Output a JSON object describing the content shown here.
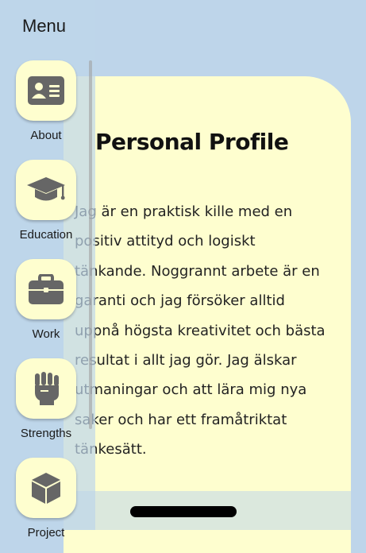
{
  "menu": {
    "title": "Menu",
    "items": [
      {
        "label": "About",
        "icon": "id-card-icon"
      },
      {
        "label": "Education",
        "icon": "graduation-cap-icon"
      },
      {
        "label": "Work",
        "icon": "briefcase-icon"
      },
      {
        "label": "Strengths",
        "icon": "fist-icon"
      },
      {
        "label": "Project",
        "icon": "cube-icon"
      }
    ]
  },
  "profile": {
    "title": "Personal Profile",
    "body": "Jag är en praktisk kille med en positiv attityd och logiskt tänkande. Noggrannt arbete är en garanti och jag försöker alltid uppnå högsta kreativitet och bästa resultat i allt jag gör. Jag älskar utmaningar och att lära mig nya saker och har ett framåtriktat tänkesätt."
  },
  "colors": {
    "background": "#bed5ea",
    "card": "#fefecf",
    "icon": "#666666"
  }
}
